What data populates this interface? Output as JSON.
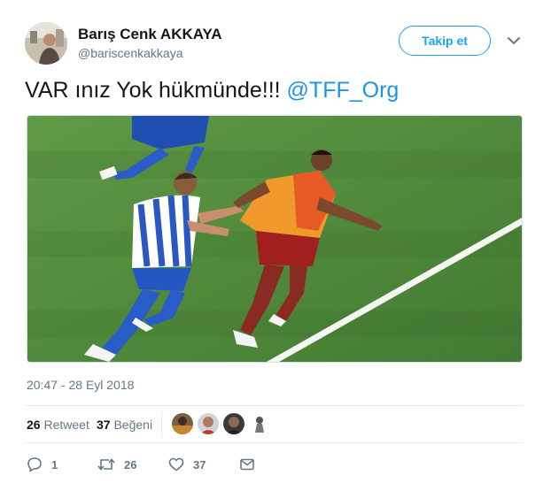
{
  "user": {
    "name": "Barış Cenk AKKAYA",
    "handle": "@bariscenkakkaya"
  },
  "follow_button": {
    "label": "Takip et"
  },
  "tweet": {
    "text": "VAR ınız Yok hükmünde!!! ",
    "mention": "@TFF_Org"
  },
  "timestamp": "20:47 - 28 Eyl 2018",
  "stats": {
    "retweets_count": "26",
    "retweets_label": "Retweet",
    "likes_count": "37",
    "likes_label": "Beğeni"
  },
  "actions": {
    "reply_count": "1",
    "retweet_count": "26",
    "like_count": "37"
  },
  "colors": {
    "accent": "#1da1f2",
    "mention": "#1b95e0",
    "muted": "#657786",
    "pitch": "#4f8a3b"
  }
}
